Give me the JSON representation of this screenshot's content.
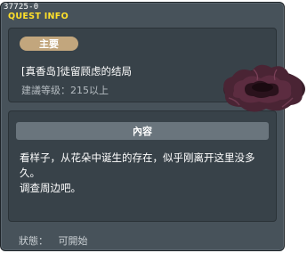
{
  "quest_id": "37725-0",
  "window_title": "QUEST INFO",
  "category_badge": "主要",
  "quest": {
    "title": "[真香岛]徒留顾虑的结局",
    "level_requirement": "建議等级：215以上"
  },
  "content": {
    "header": "內容",
    "description_line1": "看样子，从花朵中诞生的存在，似乎刚离开这里没多久。",
    "description_line2": "调查周边吧。"
  },
  "status": {
    "label": "狀態：",
    "value": "可開始"
  },
  "colors": {
    "panel_bg": "#47525a",
    "title_yellow": "#ffe02a",
    "badge_tan": "#c2a67d",
    "header_gray": "#6a757d"
  }
}
